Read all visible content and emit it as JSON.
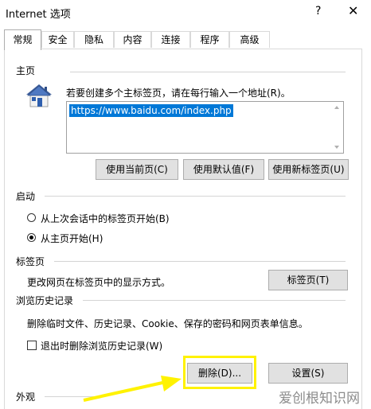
{
  "window": {
    "title": "Internet 选项",
    "help_label": "?",
    "close_label": "✕"
  },
  "tabs": [
    {
      "label": "常规",
      "active": true
    },
    {
      "label": "安全"
    },
    {
      "label": "隐私"
    },
    {
      "label": "内容"
    },
    {
      "label": "连接"
    },
    {
      "label": "程序"
    },
    {
      "label": "高级"
    }
  ],
  "home_page": {
    "group_title": "主页",
    "instruction": "若要创建多个主标签页，请在每行输入一个地址(R)。",
    "url": "https://www.baidu.com/index.php",
    "icon": "house-icon",
    "buttons": {
      "use_current": "使用当前页(C)",
      "use_default": "使用默认值(F)",
      "use_new_tab": "使用新标签页(U)"
    }
  },
  "startup": {
    "group_title": "启动",
    "option_last_session": "从上次会话中的标签页开始(B)",
    "option_home_page": "从主页开始(H)",
    "selected": "home_page"
  },
  "tabs_section": {
    "group_title": "标签页",
    "description": "更改网页在标签页中的显示方式。",
    "button": "标签页(T)"
  },
  "history": {
    "group_title": "浏览历史记录",
    "description": "删除临时文件、历史记录、Cookie、保存的密码和网页表单信息。",
    "checkbox_label": "退出时删除浏览历史记录(W)",
    "checkbox_checked": false,
    "delete_button": "删除(D)...",
    "settings_button": "设置(S)"
  },
  "appearance": {
    "group_title": "外观"
  },
  "watermark": "爱创根知识网",
  "annotation_color": "#fff200"
}
